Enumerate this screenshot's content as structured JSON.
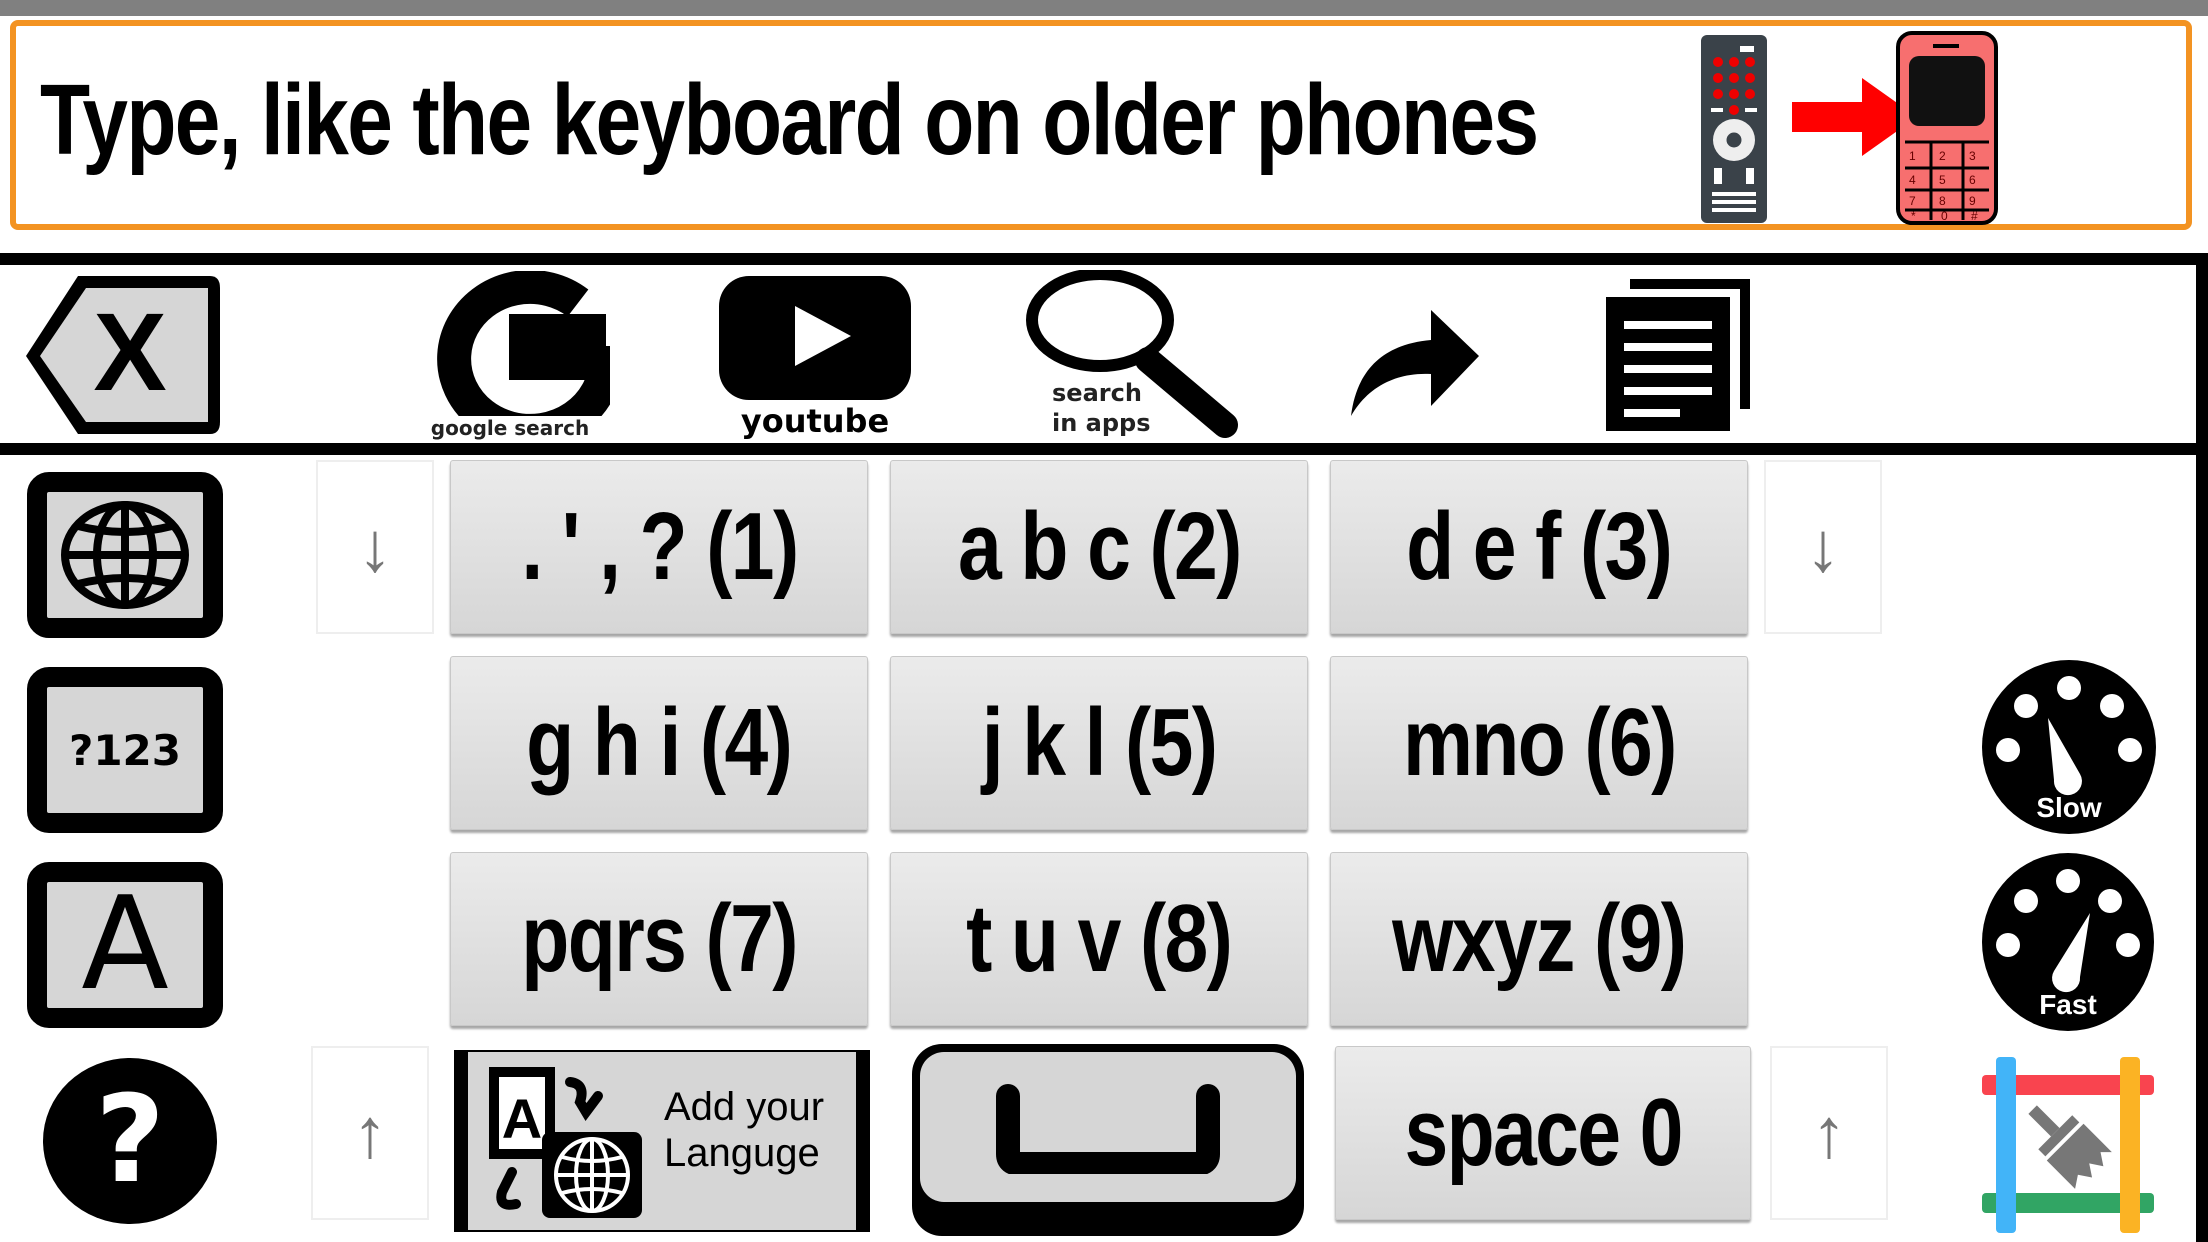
{
  "banner": {
    "title": "Type, like the keyboard on older phones",
    "remote_icon": "tv-remote-icon",
    "arrow_icon": "red-right-arrow-icon",
    "phone_icon": "feature-phone-icon",
    "colors": {
      "border": "#f39322",
      "arrow": "#ff0000",
      "phone": "#f76f6f",
      "remote": "#3a4249"
    }
  },
  "toolbar": {
    "backspace_icon": "backspace-icon",
    "google_label": "google search",
    "youtube_label": "youtube",
    "search_apps_label_line1": "search",
    "search_apps_label_line2": "in apps",
    "share_icon": "share-arrow-icon",
    "copy_icon": "copy-documents-icon"
  },
  "sidebar": {
    "globe_icon": "globe-icon",
    "numbers_label": "?123",
    "letter_label": "A",
    "help_icon": "help-icon"
  },
  "keypad": {
    "keys": [
      {
        "label": ". ' , ? (1)"
      },
      {
        "label": "a b c (2)"
      },
      {
        "label": "d e f (3)"
      },
      {
        "label": "g h i (4)"
      },
      {
        "label": "j k l (5)"
      },
      {
        "label": "mno (6)"
      },
      {
        "label": "pqrs (7)"
      },
      {
        "label": "t u v (8)"
      },
      {
        "label": "wxyz (9)"
      }
    ],
    "add_language_line1": "Add your",
    "add_language_line2": "Languge",
    "space_label": "space 0",
    "arrow_down": "↓",
    "arrow_up": "↑"
  },
  "speed": {
    "slow_label": "Slow",
    "fast_label": "Fast"
  },
  "clean": {
    "icon": "clear-brush-icon",
    "colors": {
      "top": "#f9444f",
      "left": "#42b4f8",
      "right": "#fbb324",
      "bottom": "#31a564"
    }
  }
}
